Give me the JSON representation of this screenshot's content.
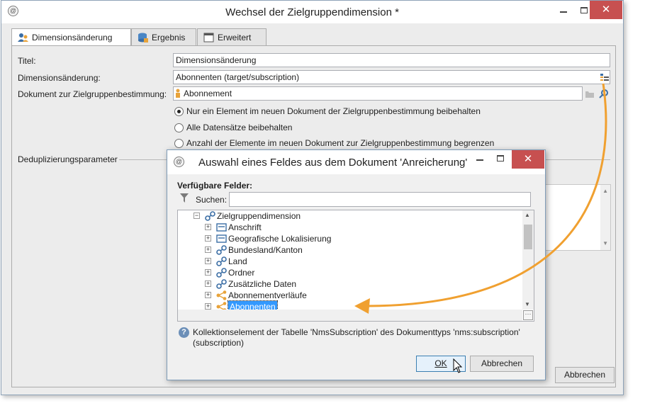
{
  "main_window": {
    "title": "Wechsel der Zielgruppendimension *",
    "tabs": [
      {
        "label": "Dimensionsänderung"
      },
      {
        "label": "Ergebnis"
      },
      {
        "label": "Erweitert"
      }
    ],
    "fields": {
      "title_label": "Titel:",
      "title_value": "Dimensionsänderung",
      "dimension_label": "Dimensionsänderung:",
      "dimension_value": "Abonnenten (target/subscription)",
      "document_label": "Dokument zur Zielgruppenbestimmung:",
      "document_value": "Abonnement"
    },
    "radio_options": [
      {
        "label": "Nur ein Element im neuen Dokument der Zielgruppenbestimmung beibehalten",
        "checked": true
      },
      {
        "label": "Alle Datensätze beibehalten",
        "checked": false
      },
      {
        "label": "Anzahl der Elemente im neuen Dokument zur Zielgruppenbestimmung begrenzen",
        "checked": false
      }
    ],
    "dedup_label": "Deduplizierungsparameter",
    "cancel_label": "Abbrechen"
  },
  "dialog": {
    "title": "Auswahl eines Feldes aus dem Dokument 'Anreicherung'",
    "available_fields_label": "Verfügbare Felder:",
    "search_label": "Suchen:",
    "search_value": "",
    "tree": {
      "root": {
        "label": "Zielgruppendimension",
        "icon": "link-icon"
      },
      "children": [
        {
          "label": "Anschrift",
          "icon": "table-icon"
        },
        {
          "label": "Geografische Lokalisierung",
          "icon": "table-icon"
        },
        {
          "label": "Bundesland/Kanton",
          "icon": "link-icon"
        },
        {
          "label": "Land",
          "icon": "link-icon"
        },
        {
          "label": "Ordner",
          "icon": "link-icon"
        },
        {
          "label": "Zusätzliche Daten",
          "icon": "link-icon"
        },
        {
          "label": "Abonnementverläufe",
          "icon": "collection-icon"
        },
        {
          "label": "Abonnenten",
          "icon": "collection-icon",
          "selected": true
        }
      ]
    },
    "help_text": "Kollektionselement der Tabelle 'NmsSubscription' des Dokumenttyps 'nms:subscription' (subscription)",
    "ok_label": "OK",
    "cancel_label": "Abbrechen"
  },
  "colors": {
    "accent_arrow": "#f0a030",
    "close_button": "#c75050",
    "selection": "#3399ff"
  }
}
